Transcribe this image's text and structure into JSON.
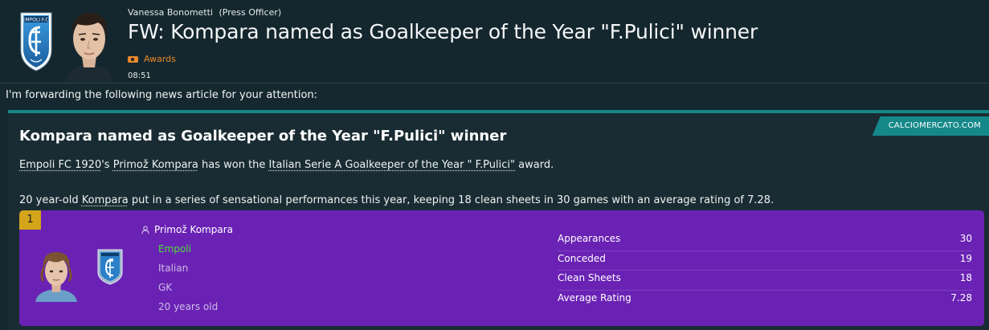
{
  "message": {
    "sender_name": "Vanessa Bonometti",
    "sender_role": "(Press Officer)",
    "subject": "FW: Kompara named as Goalkeeper of the Year \"F.Pulici\" winner",
    "tag": "Awards",
    "time": "08:51",
    "club_badge_text": "EMPOLI F.C.",
    "intro": "I'm forwarding the following news article for your attention:"
  },
  "article": {
    "source": "CALCIOMERCATO.COM",
    "title": "Kompara named as Goalkeeper of the Year \"F.Pulici\" winner",
    "para1": {
      "club": "Empoli FC 1920",
      "s1": "'s ",
      "player": "Primož Kompara",
      "s2": " has won the ",
      "award": "Italian Serie A Goalkeeper of the Year \" F.Pulici\"",
      "s3": " award."
    },
    "para2": {
      "s1": "20 year-old ",
      "player": "Kompara",
      "s2": " put in a series of sensational performances this year, keeping 18 clean sheets in 30 games with an average rating of 7.28."
    }
  },
  "card": {
    "rank": "1",
    "player_name": "Primož Kompara",
    "club": "Empoli",
    "nationality": "Italian",
    "position": "GK",
    "age": "20 years old",
    "stats": [
      {
        "label": "Appearances",
        "value": "30"
      },
      {
        "label": "Conceded",
        "value": "19"
      },
      {
        "label": "Clean Sheets",
        "value": "18"
      },
      {
        "label": "Average Rating",
        "value": "7.28"
      }
    ]
  },
  "colors": {
    "accent_teal": "#15888a",
    "card_purple": "#6a22b4",
    "rank_gold": "#d4a51a",
    "club_green": "#4fde3a",
    "tag_orange": "#e8892a",
    "badge_blue": "#2a7fc8"
  },
  "icons": [
    "club-badge-icon",
    "tag-icon",
    "person-icon"
  ]
}
